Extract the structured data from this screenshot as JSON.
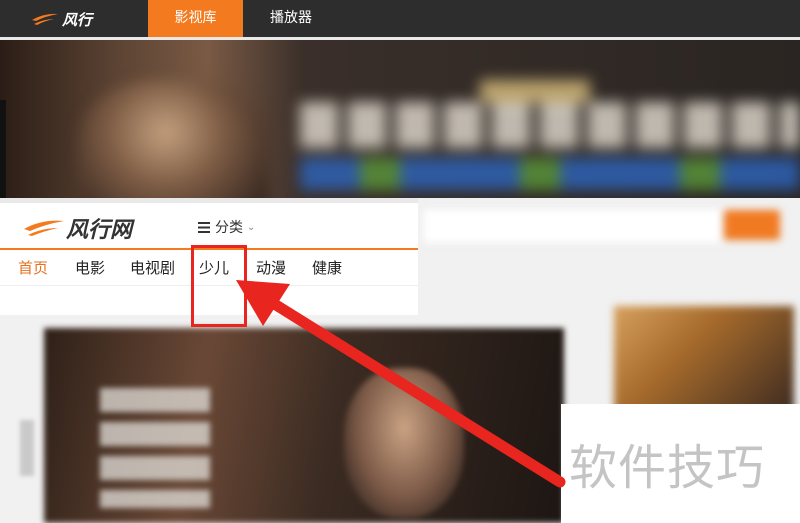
{
  "topbar": {
    "logo_text": "风行",
    "tabs": [
      {
        "label": "影视库",
        "active": true
      },
      {
        "label": "播放器",
        "active": false
      }
    ],
    "accent": "#f47a1f"
  },
  "site": {
    "logo_text": "风行网",
    "category_label": "分类",
    "nav": [
      {
        "label": "首页",
        "active": true
      },
      {
        "label": "电影",
        "active": false
      },
      {
        "label": "电视剧",
        "active": false
      },
      {
        "label": "少儿",
        "active": false
      },
      {
        "label": "动漫",
        "active": false
      },
      {
        "label": "健康",
        "active": false
      }
    ]
  },
  "annotation": {
    "highlight_color": "#e8251e",
    "highlighted_item": "少儿"
  },
  "watermark": {
    "text": "软件技巧"
  }
}
